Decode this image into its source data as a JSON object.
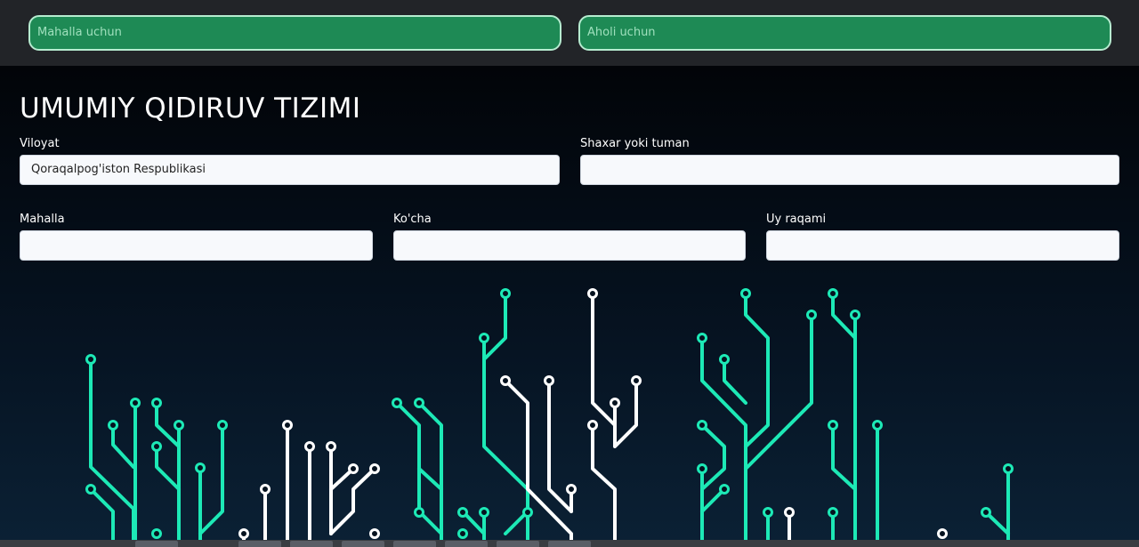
{
  "top": {
    "button_left": "Mahalla uchun",
    "button_right": "Aholi uchun"
  },
  "page": {
    "title": "UMUMIY QIDIRUV TIZIMI"
  },
  "form": {
    "region_label": "Viloyat",
    "region_value": "Qoraqalpog'iston Respublikasi",
    "city_label": "Shaxar yoki tuman",
    "city_value": "",
    "mahalla_label": "Mahalla",
    "mahalla_value": "",
    "street_label": "Ko'cha",
    "street_value": "",
    "house_label": "Uy raqami",
    "house_value": ""
  },
  "colors": {
    "accent_green": "#1e8a55",
    "circuit_teal": "#1de9b6",
    "circuit_white": "#ffffff"
  }
}
